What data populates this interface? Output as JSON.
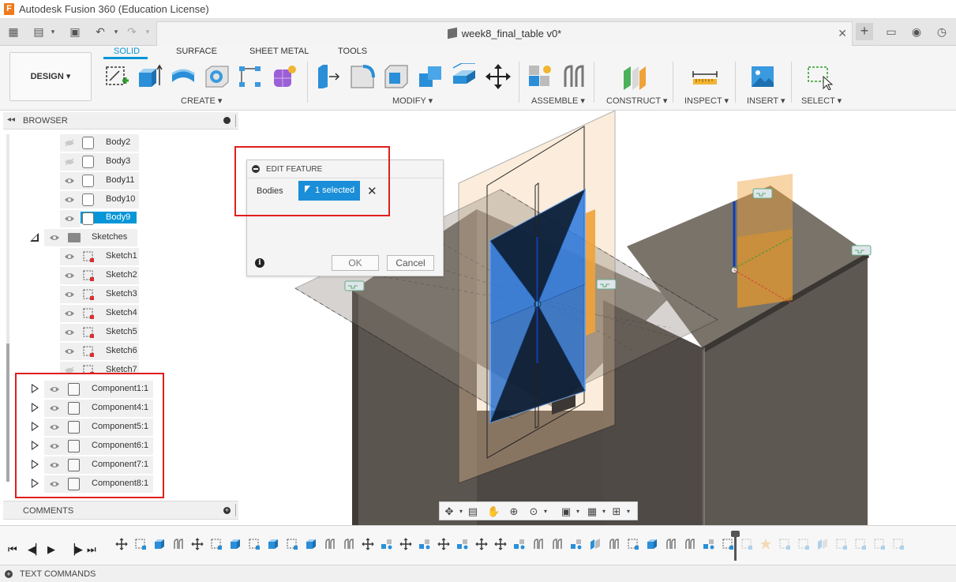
{
  "app": {
    "title": "Autodesk Fusion 360 (Education License)",
    "logo": "F"
  },
  "document": {
    "title": "week8_final_table v0*"
  },
  "ribbon": {
    "workspace": "DESIGN ▾",
    "tabs": [
      "SOLID",
      "SURFACE",
      "SHEET METAL",
      "TOOLS"
    ],
    "groups": [
      "CREATE ▾",
      "MODIFY ▾",
      "ASSEMBLE ▾",
      "CONSTRUCT ▾",
      "INSPECT ▾",
      "INSERT ▾",
      "SELECT ▾"
    ]
  },
  "browser": {
    "title": "BROWSER",
    "bodies": [
      "Body2",
      "Body3",
      "Body11",
      "Body10",
      "Body9"
    ],
    "sketches_label": "Sketches",
    "sketches": [
      "Sketch1",
      "Sketch2",
      "Sketch3",
      "Sketch4",
      "Sketch5",
      "Sketch6",
      "Sketch7"
    ],
    "components": [
      "Component1:1",
      "Component4:1",
      "Component5:1",
      "Component6:1",
      "Component7:1",
      "Component8:1"
    ]
  },
  "comments": {
    "label": "COMMENTS"
  },
  "dialog": {
    "title": "EDIT FEATURE",
    "bodies_label": "Bodies",
    "selection": "1 selected",
    "ok": "OK",
    "cancel": "Cancel"
  },
  "text_commands": {
    "label": "TEXT COMMANDS"
  },
  "colors": {
    "accent": "#0696d7",
    "highlight_box": "#e01e1e",
    "selected_body": "#1f6fd6",
    "table_body": "#5a554f"
  }
}
